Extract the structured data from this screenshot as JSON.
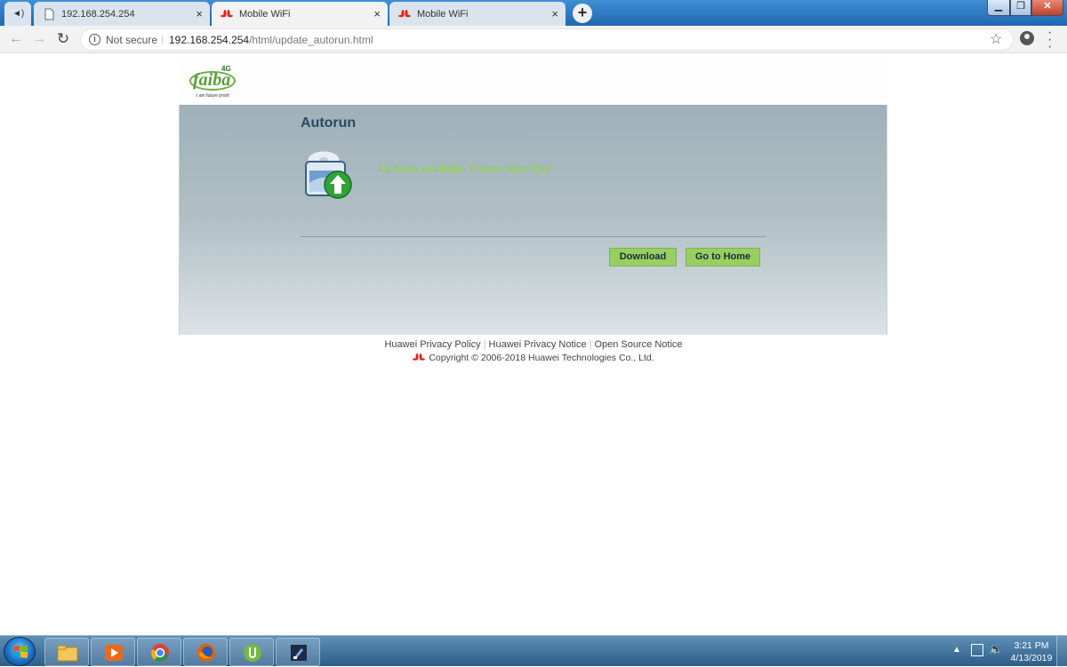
{
  "browser": {
    "tabs": [
      {
        "label": "192.168.254.254",
        "icon": "page-icon"
      },
      {
        "label": "Mobile WiFi",
        "icon": "huawei-icon"
      },
      {
        "label": "Mobile WiFi",
        "icon": "huawei-icon"
      }
    ],
    "tab_close": "×",
    "new_tab": "+",
    "security_label": "Not secure",
    "url_host": "192.168.254.254",
    "url_path": "/html/update_autorun.html"
  },
  "header": {
    "logo_text": "faiba",
    "logo_badge": "4G",
    "logo_tagline": "I am future proof"
  },
  "panel": {
    "title": "Autorun",
    "message": "Updates available. Please download.",
    "download_label": "Download",
    "home_label": "Go to Home"
  },
  "footer": {
    "links": [
      "Huawei Privacy Policy",
      "Huawei Privacy Notice",
      "Open Source Notice"
    ],
    "copyright": "Copyright © 2006-2018 Huawei Technologies Co., Ltd."
  },
  "taskbar": {
    "time": "3:21 PM",
    "date": "4/13/2019"
  },
  "colors": {
    "accent_green": "#96cf62",
    "message_green": "#8cd43a",
    "title_blue": "#2a4a66"
  }
}
